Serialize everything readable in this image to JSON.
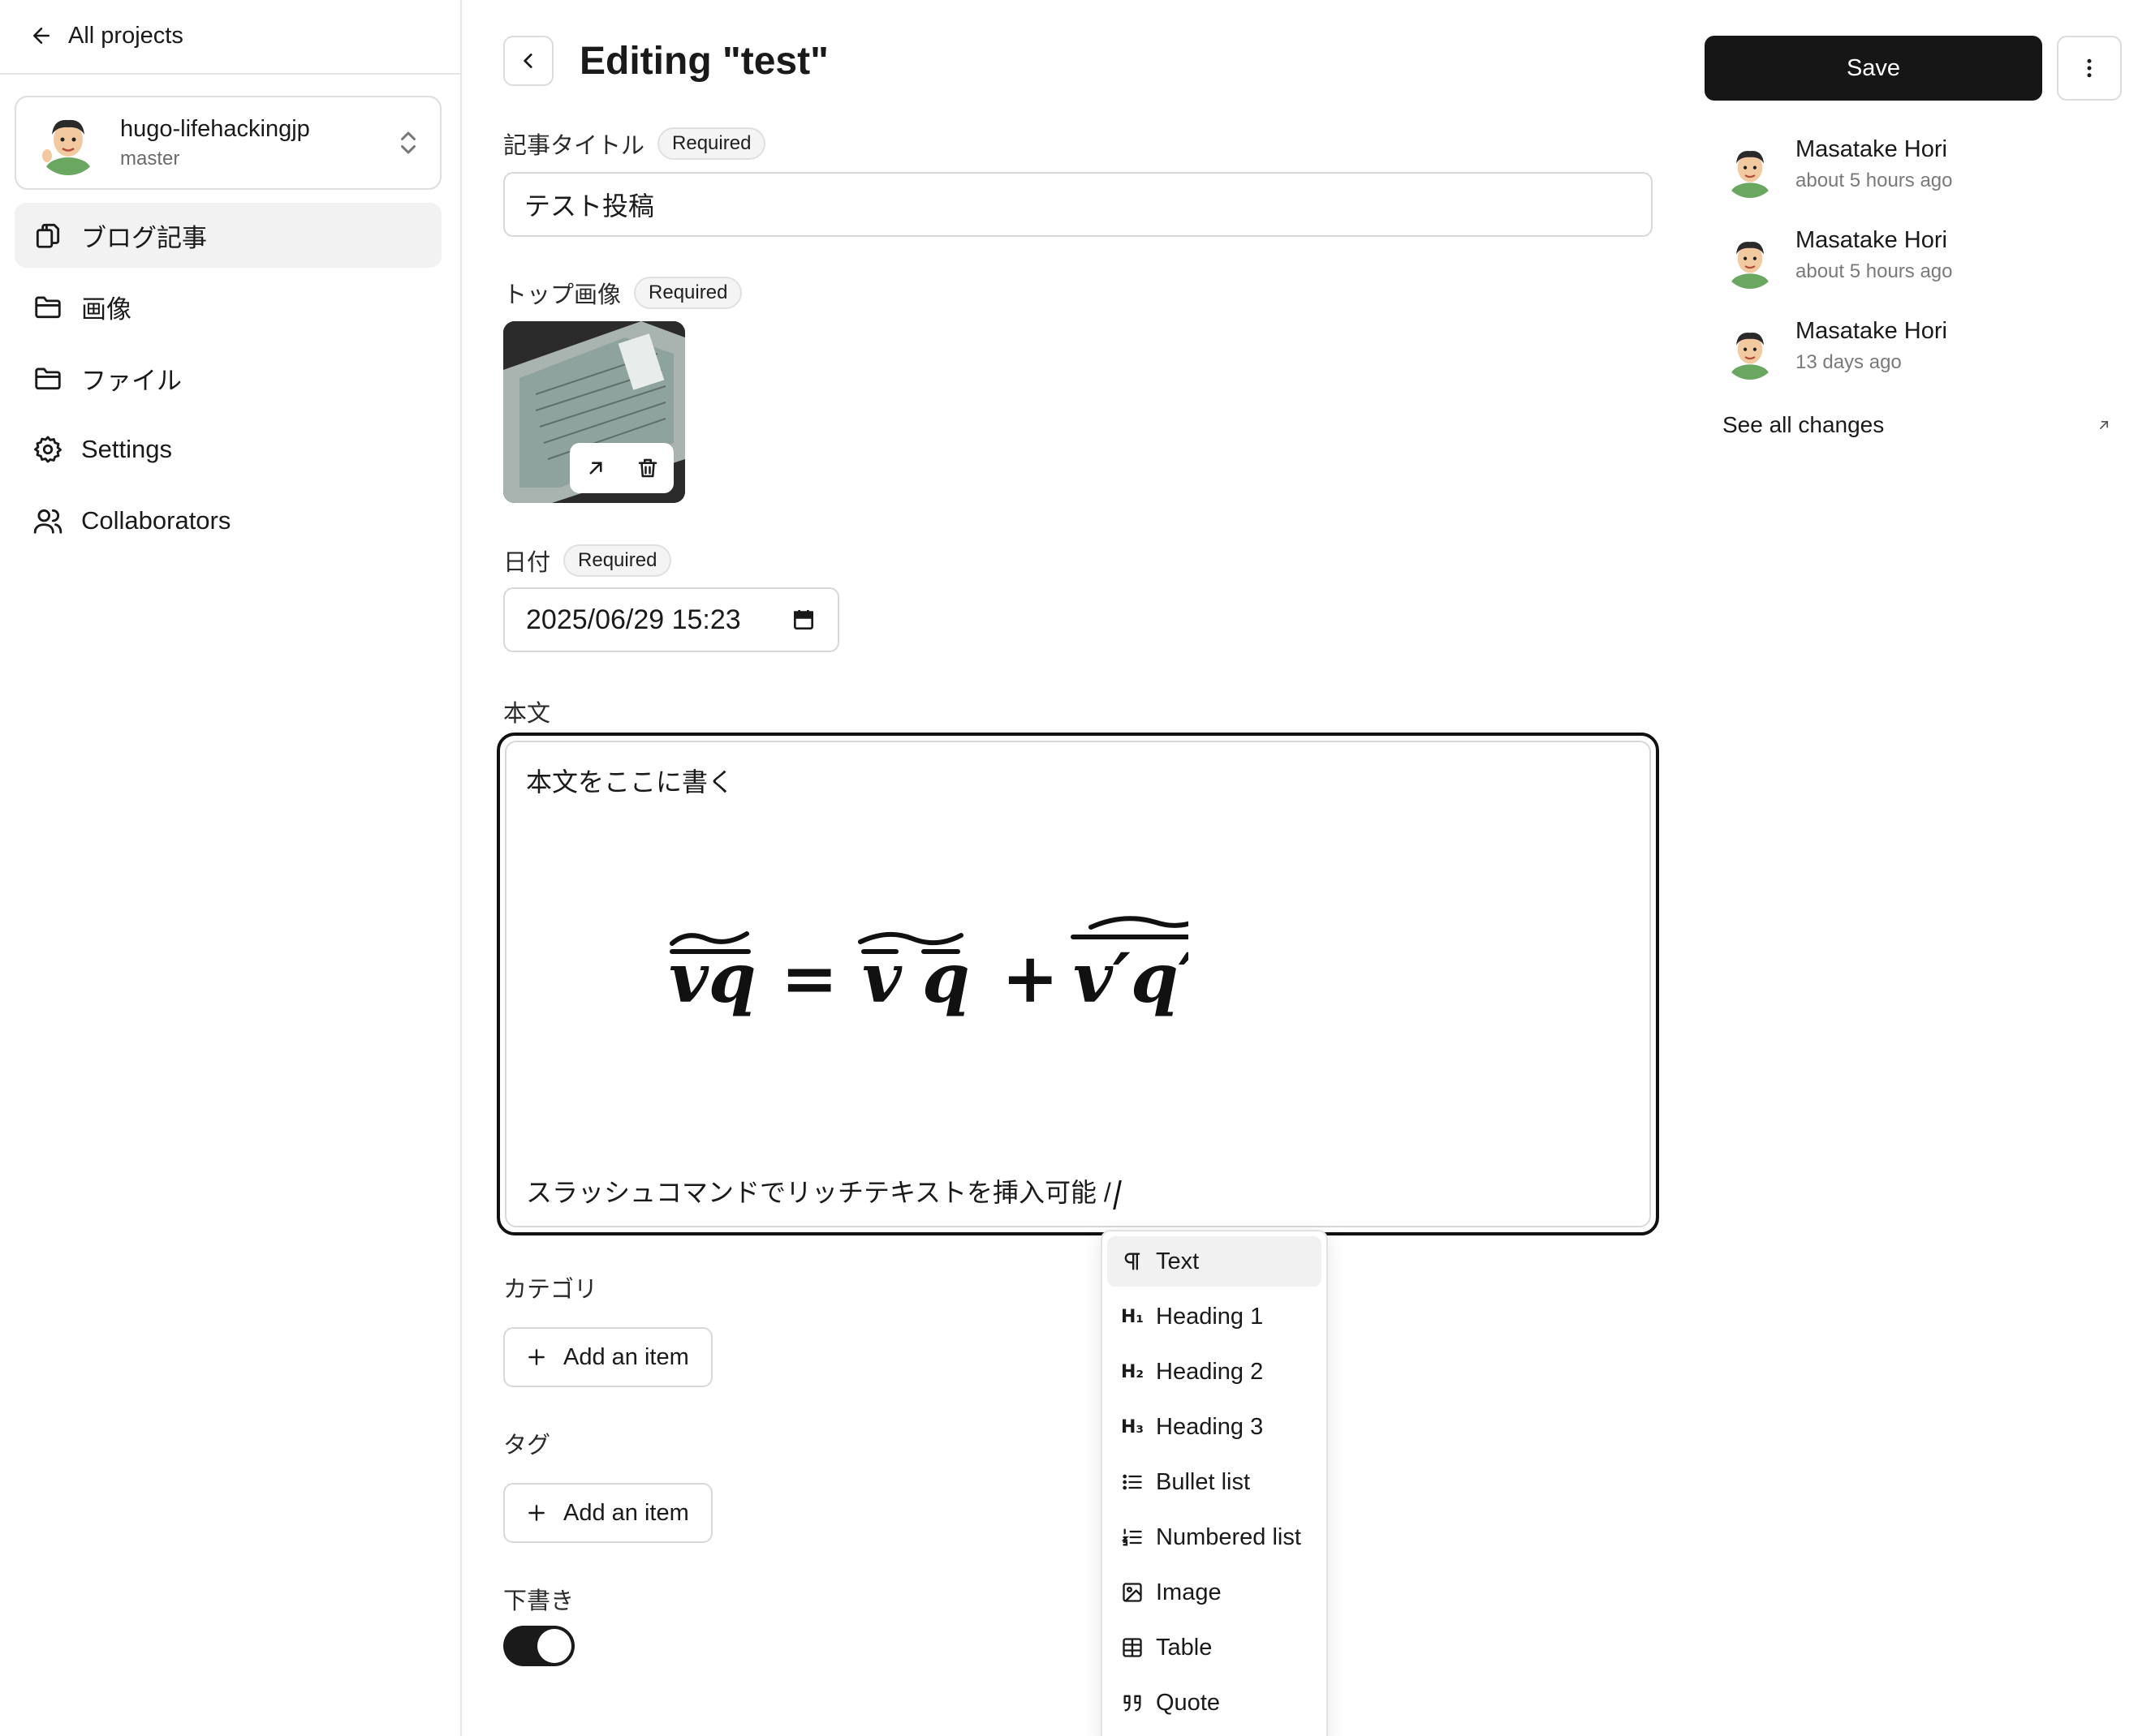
{
  "sidebar": {
    "back_label": "All projects",
    "project": {
      "name": "hugo-lifehackingjp",
      "branch": "master"
    },
    "items": [
      {
        "label": "ブログ記事",
        "icon": "documents-icon",
        "active": true
      },
      {
        "label": "画像",
        "icon": "folder-icon",
        "active": false
      },
      {
        "label": "ファイル",
        "icon": "folder-icon",
        "active": false
      },
      {
        "label": "Settings",
        "icon": "gear-icon",
        "active": false
      },
      {
        "label": "Collaborators",
        "icon": "users-icon",
        "active": false
      }
    ]
  },
  "header": {
    "title": "Editing \"test\""
  },
  "form": {
    "required_badge": "Required",
    "title_field": {
      "label": "記事タイトル",
      "value": "テスト投稿"
    },
    "image_field": {
      "label": "トップ画像"
    },
    "date_field": {
      "label": "日付",
      "value": "2025/06/29 15:23"
    },
    "body_field": {
      "label": "本文",
      "line1": "本文をここに書く",
      "line2": "スラッシュコマンドでリッチテキストを挿入可能 /"
    },
    "category_field": {
      "label": "カテゴリ",
      "add_label": "Add an item"
    },
    "tag_field": {
      "label": "タグ",
      "add_label": "Add an item"
    },
    "draft_field": {
      "label": "下書き",
      "enabled": true
    }
  },
  "slash_menu": {
    "items": [
      {
        "label": "Text",
        "icon": "paragraph-icon"
      },
      {
        "label": "Heading 1",
        "icon": "h1-icon",
        "glyph": "H₁"
      },
      {
        "label": "Heading 2",
        "icon": "h2-icon",
        "glyph": "H₂"
      },
      {
        "label": "Heading 3",
        "icon": "h3-icon",
        "glyph": "H₃"
      },
      {
        "label": "Bullet list",
        "icon": "bullet-list-icon"
      },
      {
        "label": "Numbered list",
        "icon": "numbered-list-icon"
      },
      {
        "label": "Image",
        "icon": "image-icon"
      },
      {
        "label": "Table",
        "icon": "table-icon"
      },
      {
        "label": "Quote",
        "icon": "quote-icon"
      }
    ]
  },
  "right_panel": {
    "save_label": "Save",
    "history": [
      {
        "name": "Masatake Hori",
        "time": "about 5 hours ago"
      },
      {
        "name": "Masatake Hori",
        "time": "about 5 hours ago"
      },
      {
        "name": "Masatake Hori",
        "time": "13 days ago"
      }
    ],
    "see_all_label": "See all changes"
  }
}
